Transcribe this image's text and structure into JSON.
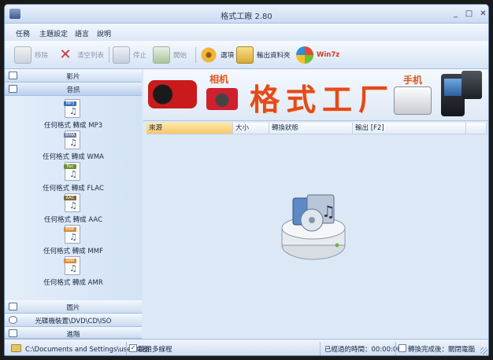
{
  "window": {
    "title": "格式工廠 2.80"
  },
  "menu": [
    "任務",
    "主題設定",
    "語言",
    "說明"
  ],
  "toolbar": {
    "remove": "移除",
    "clear_list": "清空列表",
    "stop": "停止",
    "start": "開始",
    "options": "選項",
    "output_folder": "輸出資料夾",
    "win7": "Win7z"
  },
  "sidebar": {
    "categories": {
      "video": "影片",
      "audio": "音訊",
      "picture": "圖片",
      "rom": "光碟機裝置\\DVD\\CD\\ISO",
      "advanced": "進階"
    },
    "audio_items": [
      {
        "tag": "MP3",
        "label": "任何格式 轉成 MP3"
      },
      {
        "tag": "WMA",
        "label": "任何格式 轉成 WMA"
      },
      {
        "tag": "flac",
        "label": "任何格式 轉成 FLAC"
      },
      {
        "tag": "AAC",
        "label": "任何格式 轉成 AAC"
      },
      {
        "tag": "MMF",
        "label": "任何格式 轉成 MMF"
      },
      {
        "tag": "AMR",
        "label": "任何格式 轉成 AMR"
      }
    ]
  },
  "banner": {
    "title": "格式工厂",
    "camera_label": "相机",
    "phone_label": "手机"
  },
  "table": {
    "columns": [
      "來源",
      "大小",
      "轉換狀態",
      "輸出 [F2]"
    ]
  },
  "status": {
    "path": "C:\\Documents and Settings\\user\\桌面",
    "multithread_checked": true,
    "multithread": "使用多線程",
    "elapsed": "已經過的時間：00:00:00",
    "after_convert_checked": false,
    "after_convert": "轉換完成後：關閉電腦"
  }
}
